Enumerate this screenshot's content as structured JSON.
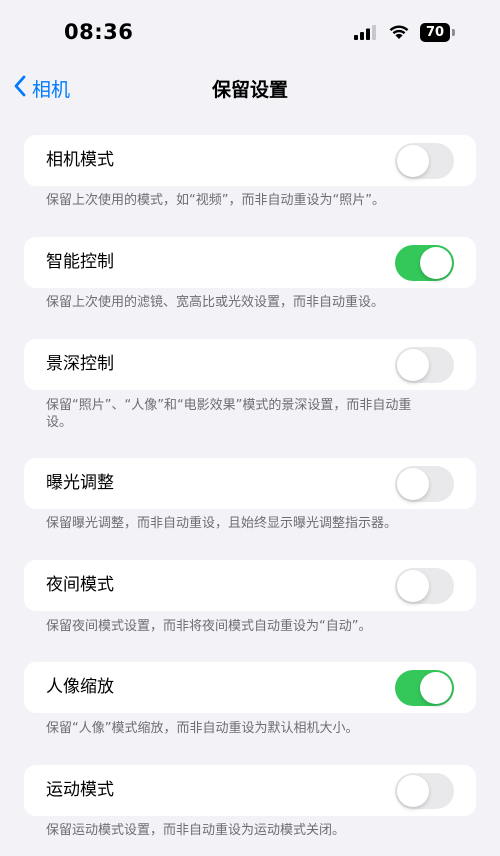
{
  "status_bar": {
    "time": "08:36",
    "battery": "70"
  },
  "nav": {
    "back_label": "相机",
    "title": "保留设置"
  },
  "settings": [
    {
      "label": "相机模式",
      "on": false,
      "footer": "保留上次使用的模式，如“视频”，而非自动重设为“照片”。"
    },
    {
      "label": "智能控制",
      "on": true,
      "footer": "保留上次使用的滤镜、宽高比或光效设置，而非自动重设。"
    },
    {
      "label": "景深控制",
      "on": false,
      "footer": "保留“照片”、“人像”和“电影效果”模式的景深设置，而非自动重设。"
    },
    {
      "label": "曝光调整",
      "on": false,
      "footer": "保留曝光调整，而非自动重设，且始终显示曝光调整指示器。"
    },
    {
      "label": "夜间模式",
      "on": false,
      "footer": "保留夜间模式设置，而非将夜间模式自动重设为“自动”。"
    },
    {
      "label": "人像缩放",
      "on": true,
      "footer": "保留“人像”模式缩放，而非自动重设为默认相机大小。"
    },
    {
      "label": "运动模式",
      "on": false,
      "footer": "保留运动模式设置，而非自动重设为运动模式关闭。"
    }
  ],
  "colors": {
    "accent": "#007aff",
    "toggle_on": "#34c759",
    "toggle_off": "#e9e9eb",
    "background": "#f2f2f7"
  }
}
